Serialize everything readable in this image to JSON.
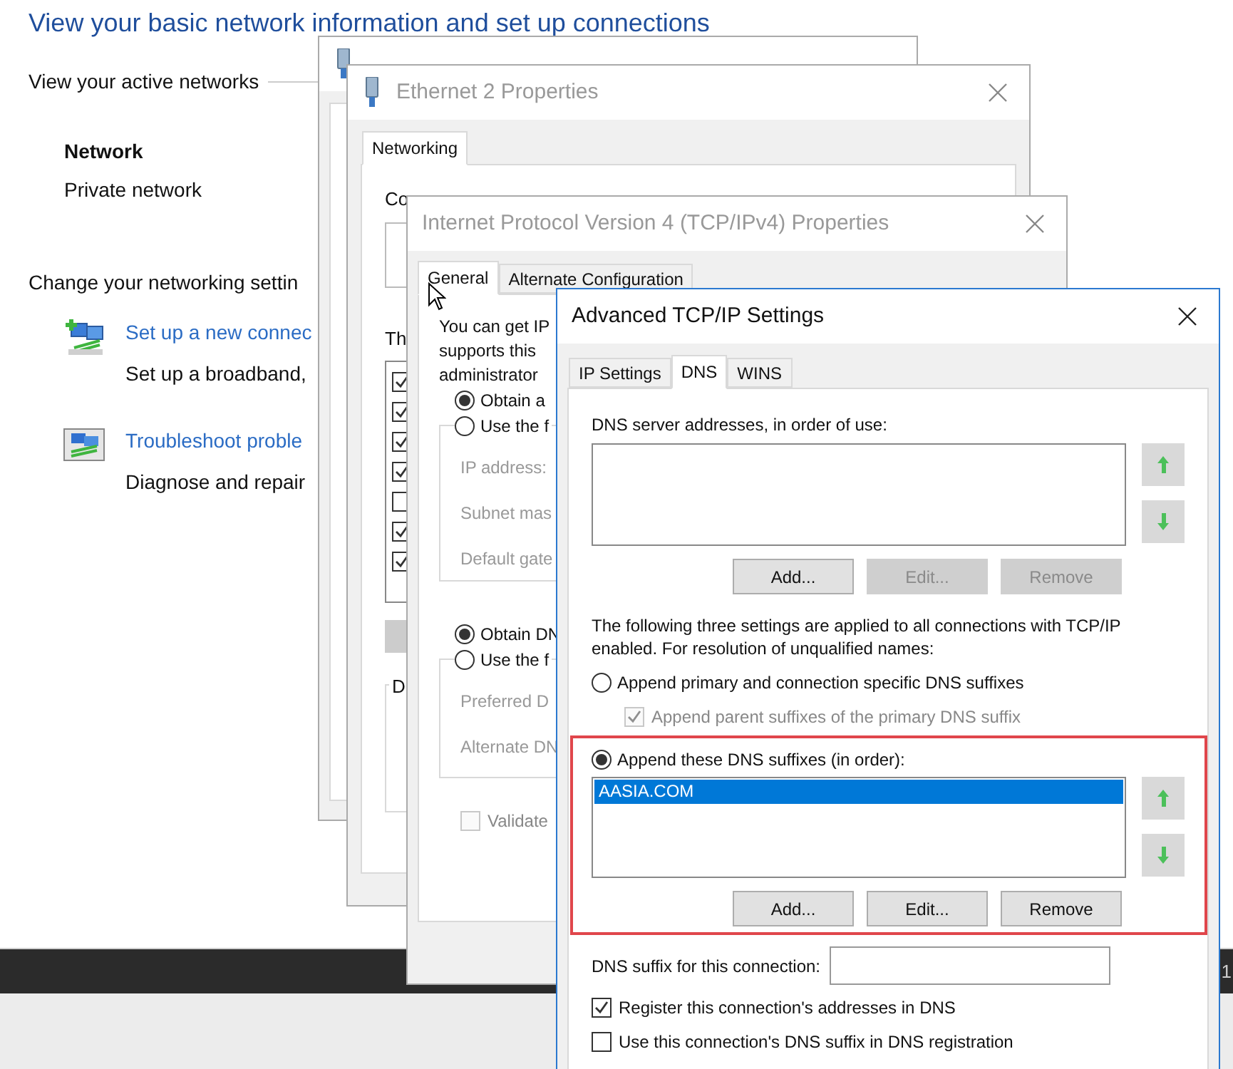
{
  "page": {
    "heading": "View your basic network information and set up connections",
    "active_networks_label": "View your active networks",
    "network": {
      "name": "Network",
      "type": "Private network"
    },
    "change_settings_label": "Change your networking settin",
    "tasks": [
      {
        "kind": "new",
        "link": "Set up a new connec",
        "description": "Set up a broadband,"
      },
      {
        "kind": "troubleshoot",
        "link": "Troubleshoot proble",
        "description": "Diagnose and repair"
      }
    ]
  },
  "taskbar": {
    "text": "1"
  },
  "windows": [
    {
      "kind": "status",
      "active": false
    },
    {
      "kind": "properties",
      "title": "Ethernet 2 Properties",
      "active": false,
      "tabs": [
        {
          "label": "Networking",
          "selected": true
        }
      ],
      "connect_using_label": "Co",
      "items_label": "Th",
      "items": [
        {
          "checked": true
        },
        {
          "checked": true
        },
        {
          "checked": true
        },
        {
          "checked": true
        },
        {
          "checked": false
        },
        {
          "checked": true
        },
        {
          "checked": true
        }
      ],
      "description_label": "D"
    },
    {
      "kind": "ipv4",
      "title": "Internet Protocol Version 4 (TCP/IPv4) Properties",
      "active": false,
      "tabs": [
        {
          "label": "General",
          "selected": true
        },
        {
          "label": "Alternate Configuration",
          "selected": false
        }
      ],
      "intro_lines": [
        "You can get IP",
        "supports this",
        "administrator"
      ],
      "ip_radios": [
        {
          "label": "Obtain a",
          "selected": true
        },
        {
          "label": "Use the f",
          "selected": false
        }
      ],
      "ip_fields": [
        "IP address:",
        "Subnet mas",
        "Default gate"
      ],
      "dns_radios": [
        {
          "label": "Obtain DN",
          "selected": true
        },
        {
          "label": "Use the f",
          "selected": false
        }
      ],
      "dns_fields": [
        "Preferred D",
        "Alternate DN"
      ],
      "validate": {
        "label": "Validate",
        "checked": false,
        "disabled": true
      }
    },
    {
      "kind": "advanced",
      "title": "Advanced TCP/IP Settings",
      "active": true,
      "tabs": [
        {
          "label": "IP Settings",
          "selected": false
        },
        {
          "label": "DNS",
          "selected": true
        },
        {
          "label": "WINS",
          "selected": false
        }
      ],
      "servers_label": "DNS server addresses, in order of use:",
      "server_buttons": [
        {
          "label": "Add...",
          "disabled": false
        },
        {
          "label": "Edit...",
          "disabled": true
        },
        {
          "label": "Remove",
          "disabled": true
        }
      ],
      "note": "The following three settings are applied to all connections with TCP/IP enabled. For resolution of unqualified names:",
      "primary_radio": {
        "label": "Append primary and connection specific DNS suffixes",
        "selected": false
      },
      "parent_checkbox": {
        "label": "Append parent suffixes of the primary DNS suffix",
        "checked": true,
        "disabled": true
      },
      "these_radio": {
        "label": "Append these DNS suffixes (in order):",
        "selected": true
      },
      "suffixes": [
        {
          "name": "AASIA.COM",
          "selected": true
        }
      ],
      "suffix_buttons": [
        {
          "label": "Add...",
          "disabled": false
        },
        {
          "label": "Edit...",
          "disabled": false
        },
        {
          "label": "Remove",
          "disabled": false
        }
      ],
      "connection_suffix_label": "DNS suffix for this connection:",
      "checkboxes": [
        {
          "label": "Register this connection's addresses in DNS",
          "checked": true
        },
        {
          "label": "Use this connection's DNS suffix in DNS registration",
          "checked": false
        }
      ]
    }
  ]
}
